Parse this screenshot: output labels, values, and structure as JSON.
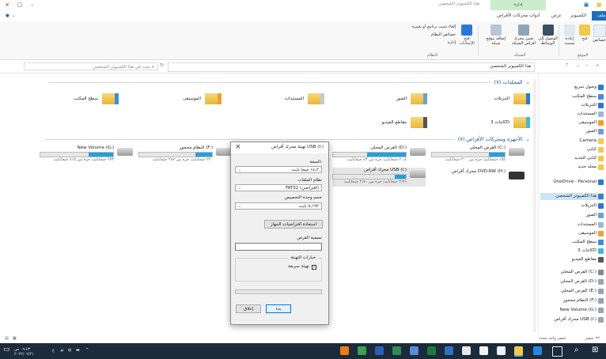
{
  "window": {
    "title": "هذا الكمبيوتر الشخصي",
    "context_tab": "إدارة"
  },
  "ribbon_tabs": {
    "file": "ملف",
    "computer": "الكمبيوتر",
    "view": "عرض",
    "drive_tools": "أدوات محركات الأقراص"
  },
  "ribbon": {
    "properties": "خصائص",
    "open": "فتح",
    "rename": "إعادة تسمية",
    "group_location": "الموقع",
    "access_media": "الوصول إلى الوسائط",
    "map_network_drive": "تعيين محرك أقراص الشبكة",
    "add_network_location": "إضافة موقع شبكة",
    "group_network": "الشبكة",
    "open_settings": "فتح الإعدادات",
    "uninstall_program": "إلغاء تثبيت برنامج أو تغييره",
    "system_properties": "خصائص النظام",
    "manage": "إدارة",
    "group_system": "النظام"
  },
  "address": {
    "path": "هذا الكمبيوتر الشخصي",
    "search_placeholder": "بحث في هذا الكمبيوتر الشخصي"
  },
  "nav": {
    "items": [
      {
        "label": "وصول سريع",
        "color": "#2a7ad5"
      },
      {
        "label": "سطح المكتب",
        "color": "#3c8fd8"
      },
      {
        "label": "التنزيلات",
        "color": "#2a7ad5"
      },
      {
        "label": "المستندات",
        "color": "#9db8d6"
      },
      {
        "label": "الموسيقى",
        "color": "#f0a030"
      },
      {
        "label": "الصور",
        "color": "#6fa0cf"
      },
      {
        "label": "Camera",
        "color": "#f2c94c"
      },
      {
        "label": "كتابي",
        "color": "#f2c94c"
      },
      {
        "label": "كتابي الجديد",
        "color": "#f2c94c"
      },
      {
        "label": "مجلد جديد",
        "color": "#f2c94c"
      },
      {
        "label": "OneDrive - Personal",
        "color": "#2a7ad5"
      },
      {
        "label": "هذا الكمبيوتر الشخصي",
        "color": "#3b7fc4"
      },
      {
        "label": "التنزيلات",
        "color": "#2a7ad5"
      },
      {
        "label": "الصور",
        "color": "#6fa0cf"
      },
      {
        "label": "المستندات",
        "color": "#9db8d6"
      },
      {
        "label": "الموسيقى",
        "color": "#f0a030"
      },
      {
        "label": "سطح المكتب",
        "color": "#3c8fd8"
      },
      {
        "label": "كائنات 3D",
        "color": "#49b6d6"
      },
      {
        "label": "مقاطع الفيديو",
        "color": "#5a5a5a"
      },
      {
        "label": "القرص المحلي (C:)",
        "color": "#7f8a96"
      },
      {
        "label": "القرص المحلي (D:)",
        "color": "#9aa3ad"
      },
      {
        "label": "القرص المحلي (E:)",
        "color": "#9aa3ad"
      },
      {
        "label": "النظام محجوز (F:)",
        "color": "#9aa3ad"
      },
      {
        "label": "New Volume (G:)",
        "color": "#9aa3ad"
      },
      {
        "label": "محرك أقراص USB (I:)",
        "color": "#9aa3ad"
      }
    ]
  },
  "main": {
    "folders_header": "المجلدات (٧)",
    "folders": [
      {
        "label": "التنزيلات",
        "color": "#2a7ad5"
      },
      {
        "label": "الصور",
        "color": "#6fa0cf"
      },
      {
        "label": "المستندات",
        "color": "#c9c9c9"
      },
      {
        "label": "الموسيقى",
        "color": "#f0a030"
      },
      {
        "label": "سطح المكتب",
        "color": "#3c8fd8"
      },
      {
        "label": "كائنات 3D",
        "color": "#49b6d6"
      },
      {
        "label": "مقاطع الفيديو",
        "color": "#555555"
      }
    ],
    "devices_header": "الأجهزة ومحركات الأقراص (٧)",
    "drives": [
      {
        "name": "القرص المحلي (C:)",
        "free": "١٥٥ جيجابايت حرة من ٢٠٠ جيجابايت",
        "fill": 0.22
      },
      {
        "name": "القرص المحلي (D:)",
        "free": "٢٠٫٤ جيجابايت حرة من ٤٣ جيجابايت",
        "fill": 0.53
      },
      {
        "name": "النظام محجوز (F:)",
        "free": "٢٢٠ جيجابايت حرة من ٢٨٧ جيجابايت",
        "fill": 0.23
      },
      {
        "name": "New Volume (G:)",
        "free": "٢٧٣ جيجابايت حرة من ٤١٥ جيجابايت",
        "fill": 0.34
      },
      {
        "name": "محرك أقراص DVD-RW (H:)",
        "free": "",
        "fill": 0
      },
      {
        "name": "محرك أقراص USB (I:)",
        "free": "٢٫٢٩ جيجابايت حرة من ٢٫٧٠ جيجابايت",
        "fill": 0.15
      }
    ]
  },
  "dialog": {
    "title": "تهيئة محرك أقراص USB (I:)",
    "capacity_label": "السعة:",
    "capacity_value": "١٤٫٢ جيجا بايت",
    "fs_label": "نظام الملفات",
    "fs_value": "FAT32 (افتراضي)",
    "alloc_label": "حجم وحدة التخصيص",
    "alloc_value": "٨٫١٩٢ بايت",
    "restore_button": "استعادة افتراضيات الجهاز",
    "vol_label": "تسمية القرص",
    "vol_value": "",
    "options_label": "خيارات التهيئة",
    "quick_format": "تهيئة سريعة",
    "start_button": "بدء",
    "close_button": "إغلاق",
    "close_x": "×"
  },
  "status": {
    "count": "٢٢ عنصر",
    "selected": "عنصر واحد محدد"
  },
  "taskbar": {
    "time": "٠٩:٤٣ ص",
    "date": "٢٠٢٢/٠٩/٢١",
    "lang": "ع"
  }
}
